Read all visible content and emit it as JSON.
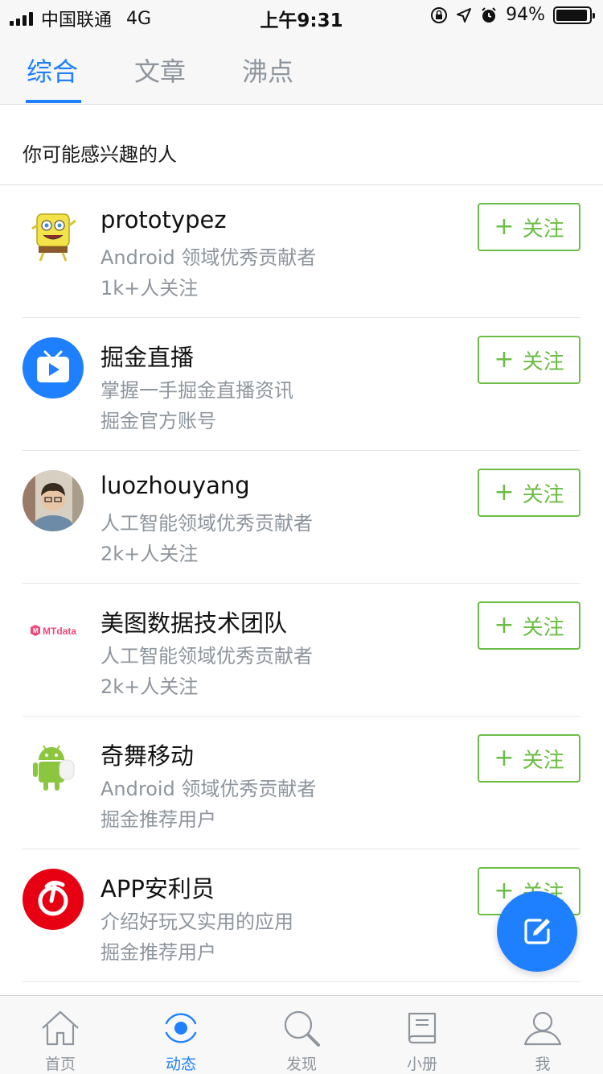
{
  "status_bar": {
    "carrier": "中国联通",
    "network": "4G",
    "time": "上午9:31",
    "battery": "94%",
    "battery_level": 0.94
  },
  "tabs": [
    {
      "label": "综合",
      "active": true
    },
    {
      "label": "文章",
      "active": false
    },
    {
      "label": "沸点",
      "active": false
    }
  ],
  "section": {
    "title": "你可能感兴趣的人"
  },
  "follow_label": "关注",
  "users": [
    {
      "name": "prototypez",
      "desc": "Android 领域优秀贡献者",
      "meta": "1k+人关注",
      "avatar": "spongebob-avatar"
    },
    {
      "name": "掘金直播",
      "desc": "掌握一手掘金直播资讯",
      "meta": "掘金官方账号",
      "avatar": "tv-play-avatar"
    },
    {
      "name": "luozhouyang",
      "desc": "人工智能领域优秀贡献者",
      "meta": "2k+人关注",
      "avatar": "person-photo-avatar"
    },
    {
      "name": "美图数据技术团队",
      "desc": "人工智能领域优秀贡献者",
      "meta": "2k+人关注",
      "avatar": "mtdata-logo-avatar",
      "logo_text": "MTdata"
    },
    {
      "name": "奇舞移动",
      "desc": "Android 领域优秀贡献者",
      "meta": "掘金推荐用户",
      "avatar": "android-robot-avatar"
    },
    {
      "name": "APP安利员",
      "desc": "介绍好玩又实用的应用",
      "meta": "掘金推荐用户",
      "avatar": "netease-music-avatar"
    }
  ],
  "bottom_nav": [
    {
      "label": "首页",
      "icon": "home-icon",
      "active": false
    },
    {
      "label": "动态",
      "icon": "activity-icon",
      "active": true
    },
    {
      "label": "发现",
      "icon": "search-icon",
      "active": false
    },
    {
      "label": "小册",
      "icon": "book-icon",
      "active": false
    },
    {
      "label": "我",
      "icon": "user-icon",
      "active": false
    }
  ],
  "colors": {
    "accent": "#1e80ff",
    "follow_green": "#6cbd45",
    "muted_text": "#8e959d"
  }
}
